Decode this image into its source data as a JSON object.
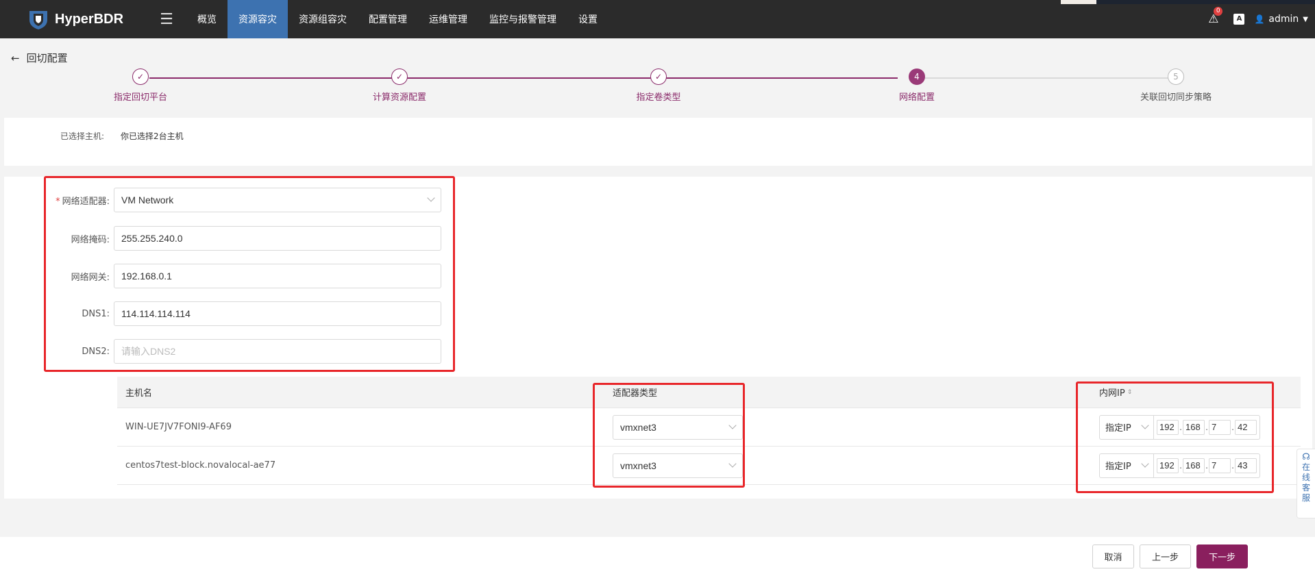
{
  "app": {
    "name": "HyperBDR"
  },
  "nav": {
    "items": [
      {
        "label": "概览"
      },
      {
        "label": "资源容灾"
      },
      {
        "label": "资源组容灾"
      },
      {
        "label": "配置管理"
      },
      {
        "label": "运维管理"
      },
      {
        "label": "监控与报警管理"
      },
      {
        "label": "设置"
      }
    ],
    "active_index": 1,
    "alert_count": "0",
    "lang_icon": "A",
    "user": "admin"
  },
  "page": {
    "back_label": "回切配置"
  },
  "steps": [
    {
      "label": "指定回切平台",
      "state": "done"
    },
    {
      "label": "计算资源配置",
      "state": "done"
    },
    {
      "label": "指定卷类型",
      "state": "done"
    },
    {
      "label": "网络配置",
      "state": "current",
      "number": "4"
    },
    {
      "label": "关联回切同步策略",
      "state": "pending",
      "number": "5"
    }
  ],
  "selected_hosts": {
    "label": "已选择主机:",
    "value": "你已选择2台主机"
  },
  "form": {
    "adapter": {
      "label": "网络适配器:",
      "value": "VM Network"
    },
    "netmask": {
      "label": "网络掩码:",
      "value": "255.255.240.0"
    },
    "gateway": {
      "label": "网络网关:",
      "value": "192.168.0.1"
    },
    "dns1": {
      "label": "DNS1:",
      "value": "114.114.114.114"
    },
    "dns2": {
      "label": "DNS2:",
      "placeholder": "请输入DNS2"
    }
  },
  "table": {
    "headers": {
      "host": "主机名",
      "adapter_type": "适配器类型",
      "internal_ip": "内网IP"
    },
    "rows": [
      {
        "host": "WIN-UE7JV7FONI9-AF69",
        "adapter_type": "vmxnet3",
        "ip_mode": "指定IP",
        "ip": [
          "192",
          "168",
          "7",
          "42"
        ]
      },
      {
        "host": "centos7test-block.novalocal-ae77",
        "adapter_type": "vmxnet3",
        "ip_mode": "指定IP",
        "ip": [
          "192",
          "168",
          "7",
          "43"
        ]
      }
    ]
  },
  "footer": {
    "cancel": "取消",
    "prev": "上一步",
    "next": "下一步"
  },
  "online_service": {
    "text": [
      "在",
      "线",
      "客",
      "服"
    ]
  },
  "colors": {
    "accent": "#8a1f5e",
    "nav_active": "#3d72b0",
    "annotation": "#e8262a"
  }
}
